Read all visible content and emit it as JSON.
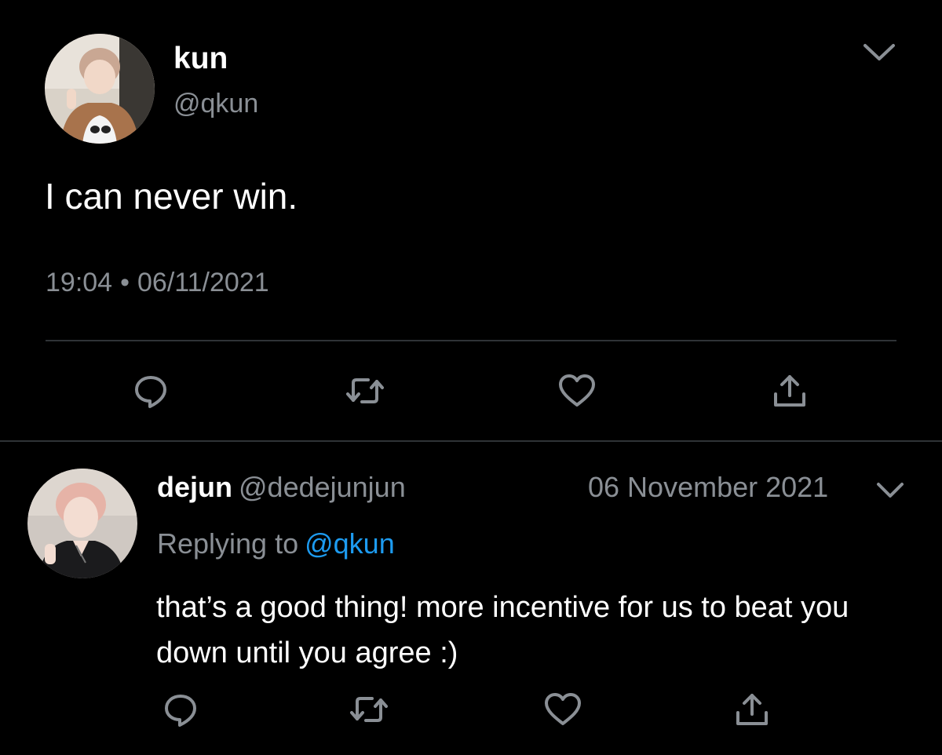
{
  "main_tweet": {
    "display_name": "kun",
    "handle": "@qkun",
    "text": "I can never win.",
    "time": "19:04",
    "separator": "•",
    "date": "06/11/2021",
    "avatar_icon": "profile-photo",
    "menu_icon": "chevron-down-icon",
    "actions": [
      "reply-icon",
      "retweet-icon",
      "like-icon",
      "share-icon"
    ]
  },
  "reply_tweet": {
    "display_name": "dejun",
    "handle": "@dedejunjun",
    "date": "06 November 2021",
    "replying_to_label": "Replying to",
    "replying_to_handle": "@qkun",
    "text": "that’s a good thing! more incentive for us to beat you down until you agree :)",
    "avatar_icon": "profile-photo",
    "menu_icon": "chevron-down-icon",
    "actions": [
      "reply-icon",
      "retweet-icon",
      "like-icon",
      "share-icon"
    ]
  },
  "colors": {
    "background": "#000000",
    "text_primary": "#ffffff",
    "text_secondary": "#8a8f95",
    "mention_link": "#1d9bf0",
    "divider": "#2f3336",
    "icon": "#8a8f95"
  }
}
